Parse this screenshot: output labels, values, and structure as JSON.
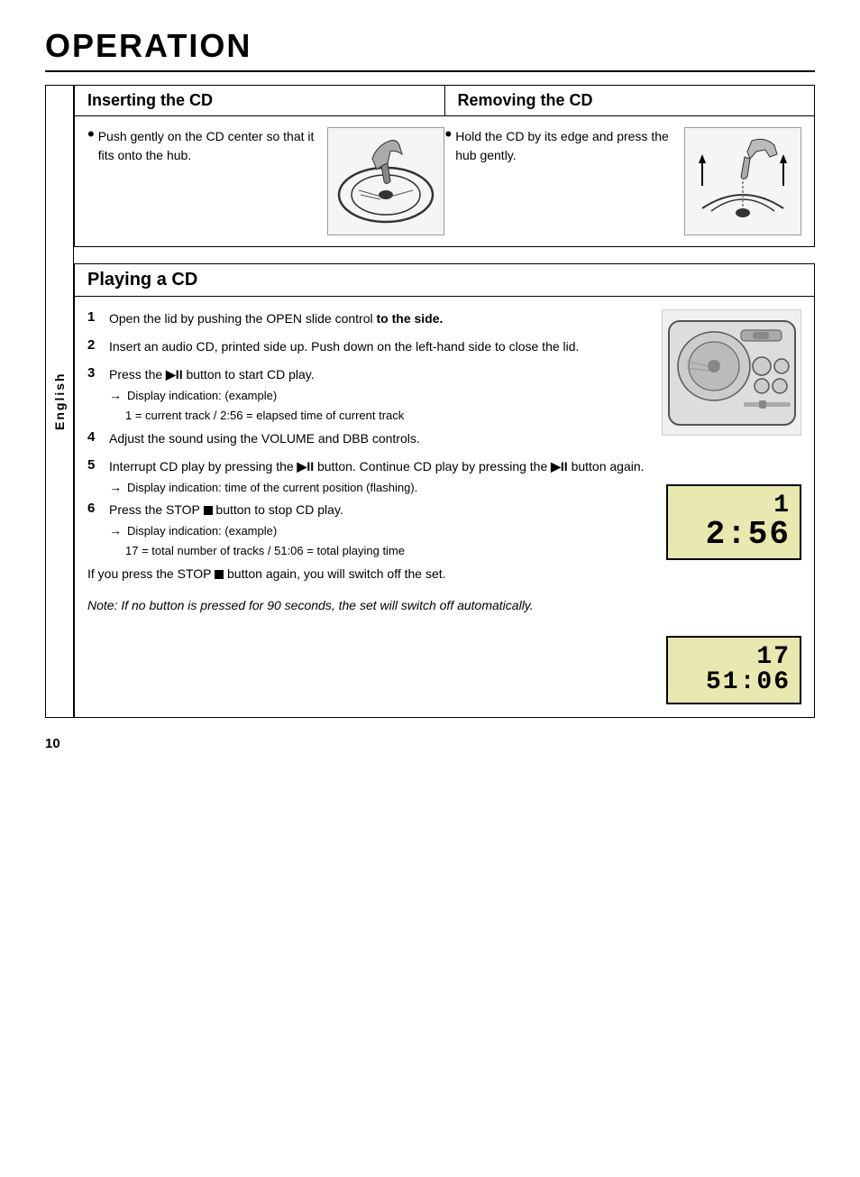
{
  "page": {
    "title": "OPERATION",
    "page_number": "10"
  },
  "sidebar": {
    "label": "English"
  },
  "insert_remove_section": {
    "left_header": "Inserting the CD",
    "right_header": "Removing the CD",
    "insert_bullet": "Push gently on the CD center so that it fits onto the hub.",
    "remove_bullet": "Hold the CD by its edge and press the hub gently."
  },
  "playing_section": {
    "header": "Playing a CD",
    "steps": [
      {
        "num": "1",
        "text": "Open the lid by pushing the OPEN slide control to the side.",
        "bold_part": "to the side."
      },
      {
        "num": "2",
        "text": "Insert an audio CD, printed side up. Push down on the left-hand side to close the lid."
      },
      {
        "num": "3",
        "text": "Press the ▶II button to start CD play.",
        "arrows": [
          {
            "label": "→ Display indication: (example)",
            "sub": "1 = current track / 2:56 = elapsed time of current track"
          }
        ]
      },
      {
        "num": "4",
        "text": "Adjust the sound using the VOLUME and DBB controls."
      },
      {
        "num": "5",
        "text": "Interrupt CD play by pressing the ▶II button. Continue CD play by pressing the ▶II button again.",
        "arrows": [
          {
            "label": "→ Display indication: time of the current position (flashing)."
          }
        ]
      },
      {
        "num": "6",
        "text": "Press the STOP ■ button to stop CD play.",
        "arrows": [
          {
            "label": "→ Display indication: (example)",
            "sub": "17 = total number of tracks / 51:06 = total playing time"
          }
        ],
        "extra": "If you press the STOP ■ button again, you will switch off the set."
      }
    ],
    "lcd1": {
      "track": "1",
      "time": "2:56"
    },
    "lcd2": {
      "track": "17",
      "time": "51:06"
    },
    "note": "Note: If no button is pressed for 90 seconds, the set will switch off automatically."
  }
}
